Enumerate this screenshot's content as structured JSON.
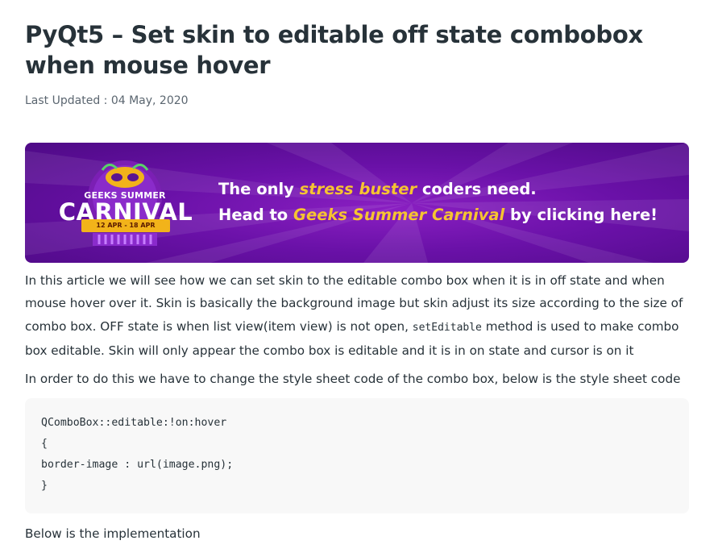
{
  "article": {
    "title": "PyQt5 – Set skin to editable off state combobox when mouse hover",
    "last_updated": "Last Updated : 04 May, 2020"
  },
  "banner": {
    "logo_line1": "GEEKS SUMMER",
    "logo_line2": "CARNIVAL",
    "logo_dates": "12 APR - 18 APR",
    "line1_pre": "The only ",
    "line1_highlight": "stress buster",
    "line1_post": " coders need.",
    "line2_pre": "Head to ",
    "line2_highlight": "Geeks Summer Carnival",
    "line2_post": " by clicking here!",
    "colors": {
      "background": "#6a11a8",
      "highlight": "#f6c431",
      "ribbon": "#f2b31a"
    }
  },
  "content": {
    "p1_a": "In this article we will see how we can set skin to the editable combo box when it is in off state and when mouse hover over it. Skin is basically the background image but skin adjust its size according to the size of combo box. OFF state is when list view(item view) is not open, ",
    "p1_code": "setEditable",
    "p1_b": " method is used to make combo box editable. Skin will only appear the combo box is editable and it is in on state and cursor is on it",
    "p2": "In order to do this we have to change the style sheet code of the combo box, below is the style sheet code",
    "code_lines": [
      "QComboBox::editable:!on:hover",
      "{",
      "border-image : url(image.png);",
      "}"
    ],
    "p3": "Below is the implementation"
  }
}
